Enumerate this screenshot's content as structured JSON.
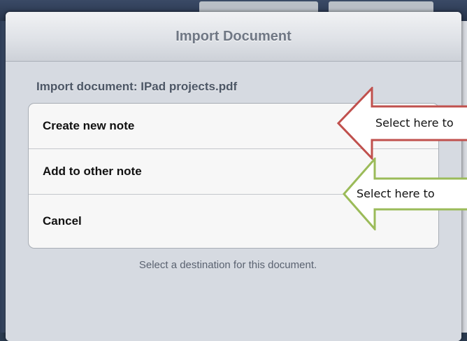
{
  "dialog": {
    "title": "Import Document",
    "section_label": "Import document: IPad projects.pdf",
    "options": [
      "Create new note",
      "Add to other note",
      "Cancel"
    ],
    "footer": "Select a destination for this document."
  },
  "annotations": {
    "red_arrow_text": "Select here to",
    "green_arrow_text": "Select here to",
    "red_color": "#c0504d",
    "green_color": "#9bbb59"
  }
}
